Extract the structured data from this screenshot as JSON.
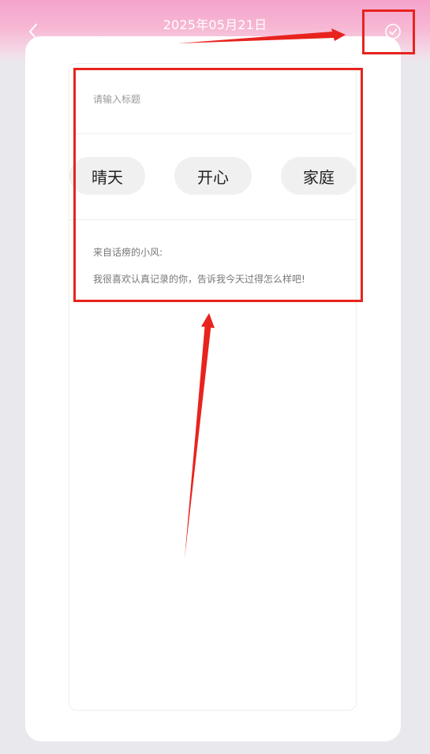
{
  "header": {
    "date_title": "2025年05月21日",
    "back_icon": "chevron-left-icon",
    "confirm_icon": "check-circle-icon"
  },
  "editor": {
    "title_placeholder": "请输入标题",
    "tags": [
      {
        "label": "晴天"
      },
      {
        "label": "开心"
      },
      {
        "label": "家庭"
      }
    ],
    "hint_from": "来自话痨的小风:",
    "hint_text": "我很喜欢认真记录的你，告诉我今天过得怎么样吧!"
  },
  "annotations": {
    "highlight_color": "#e8231e"
  },
  "colors": {
    "header_gradient_top": "#f5a3cb",
    "page_background": "#e9e8ec",
    "tag_background": "#f0f0f0"
  }
}
